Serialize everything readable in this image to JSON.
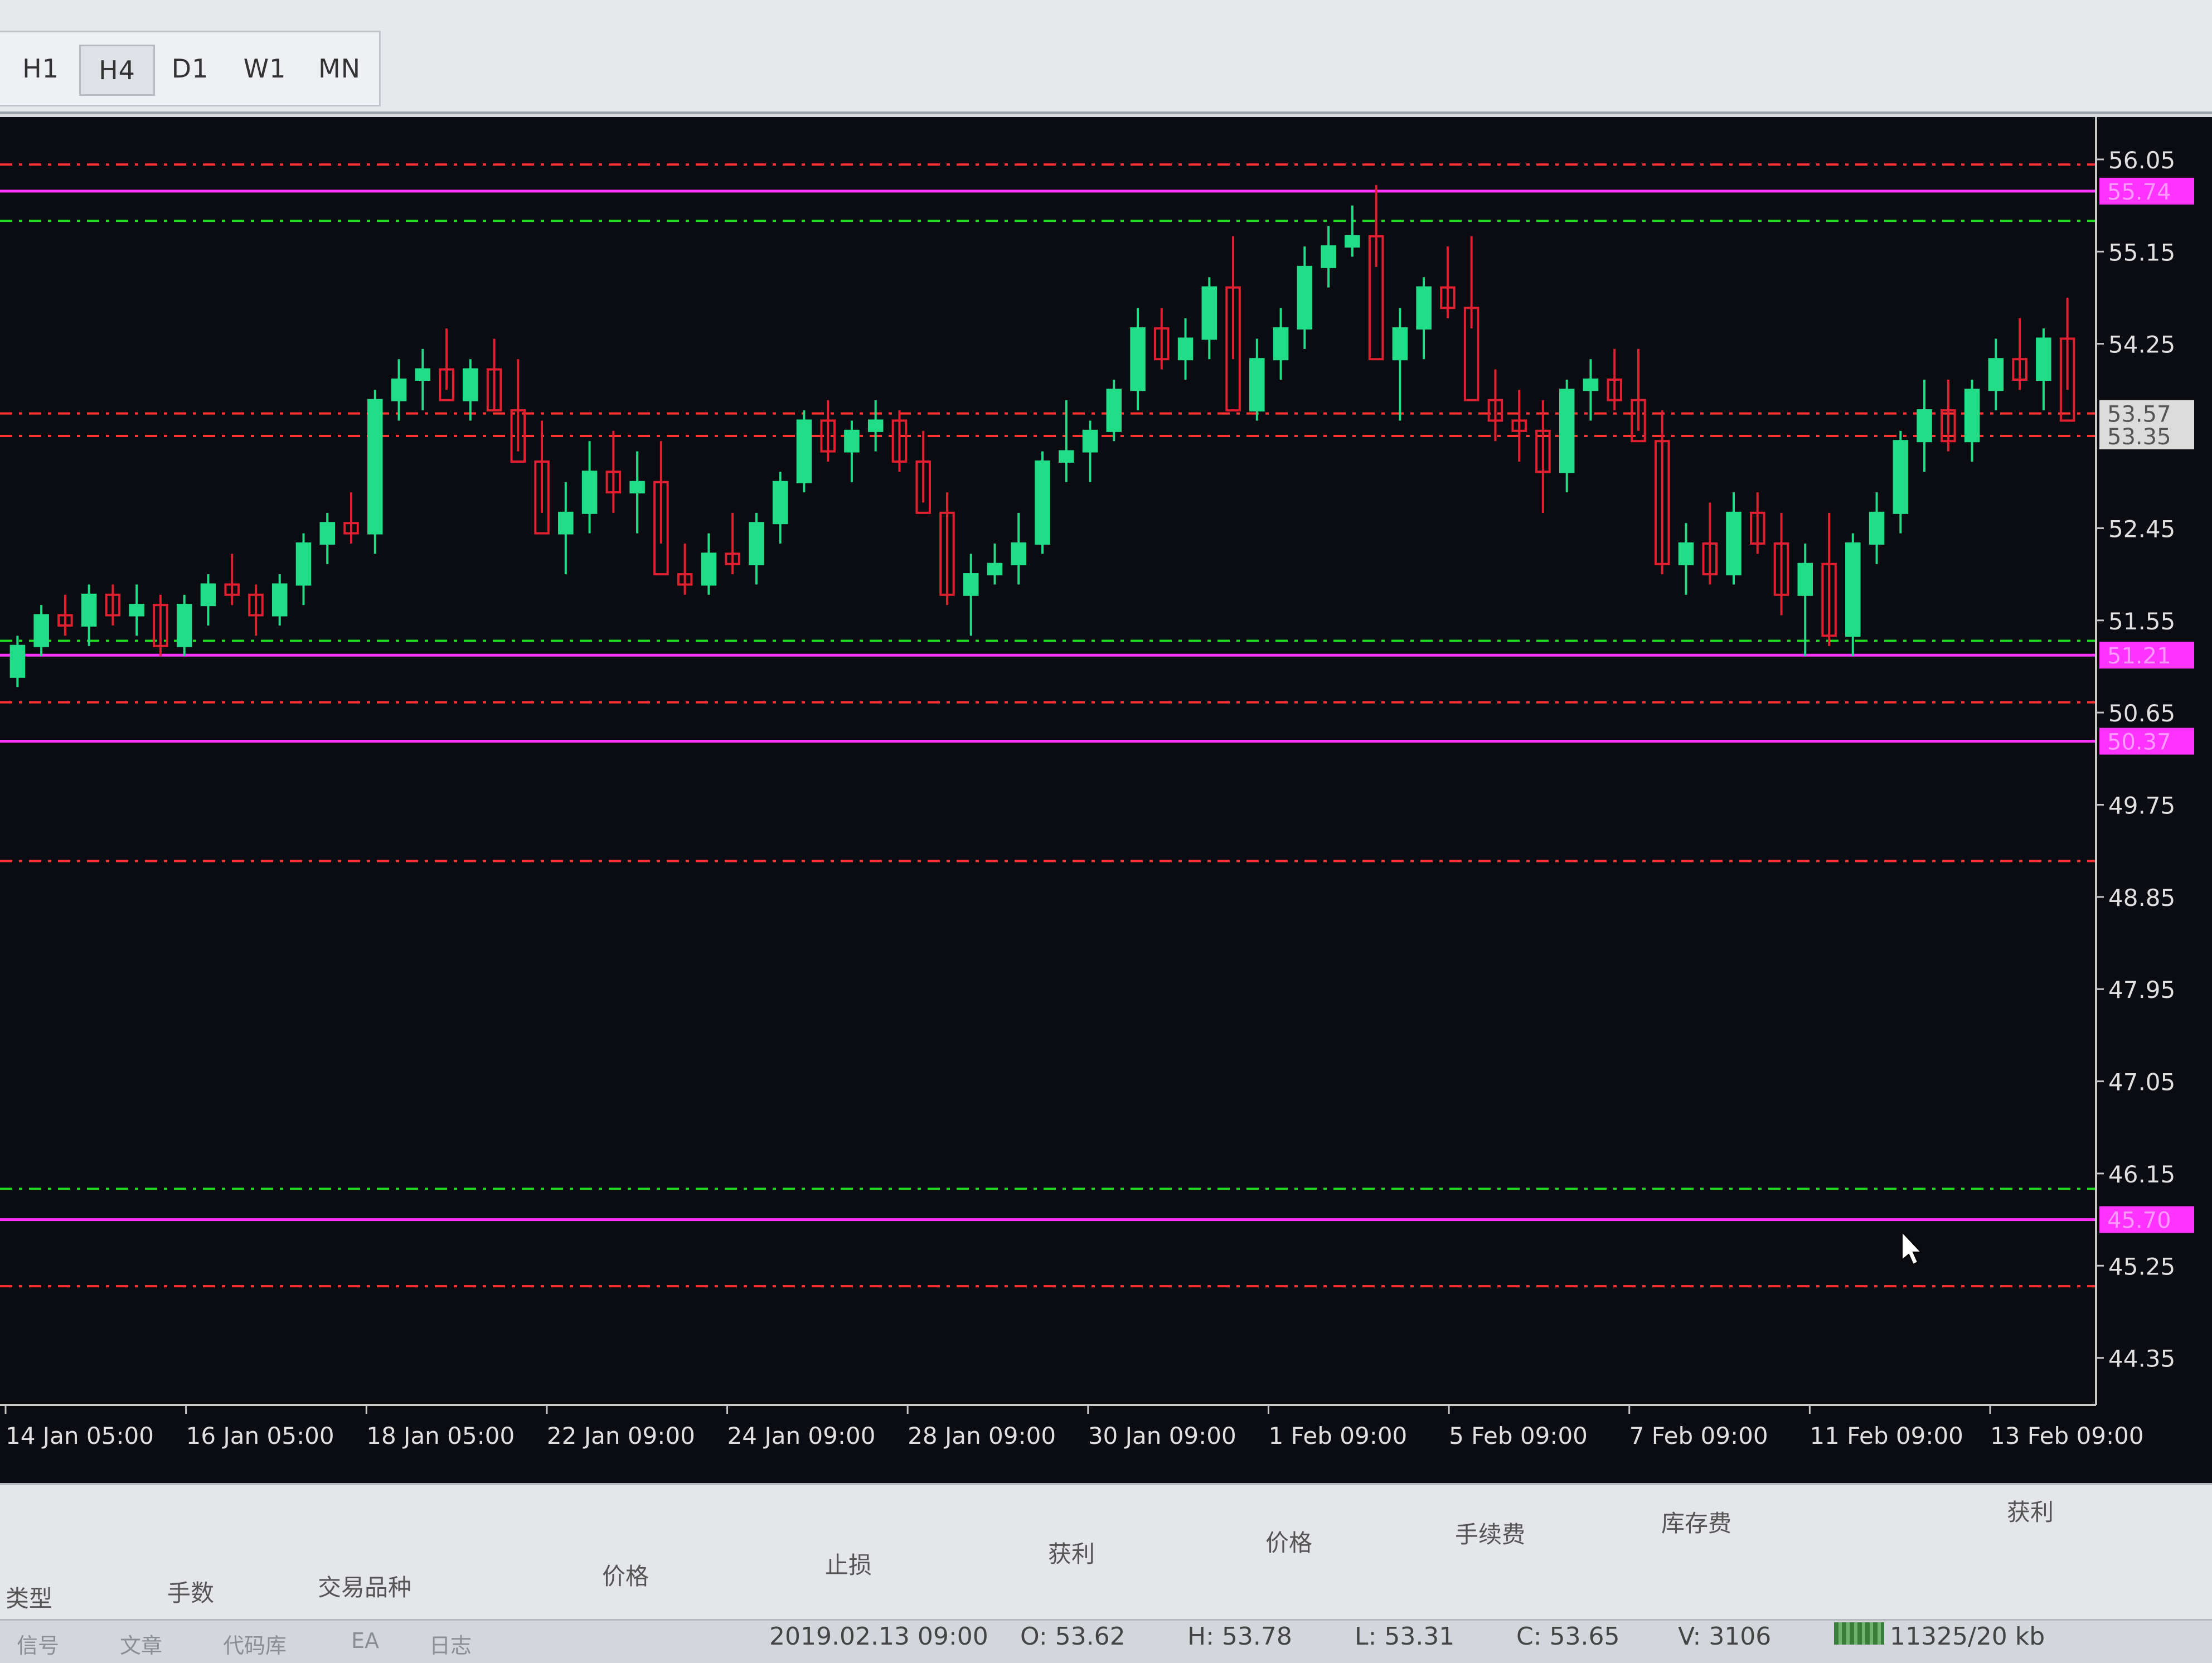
{
  "toolbar": {
    "timeframes": [
      "H1",
      "H4",
      "D1",
      "W1",
      "MN"
    ],
    "active_timeframe": "H4"
  },
  "chart_data": {
    "type": "candlestick",
    "price_scale": {
      "tick_labels": [
        "56.05",
        "55.15",
        "54.25",
        "52.45",
        "51.55",
        "50.65",
        "49.75",
        "48.85",
        "47.95",
        "47.05",
        "46.15",
        "45.25",
        "44.35"
      ],
      "highlighted_labels": [
        {
          "text": "55.74",
          "color": "#ff33ff"
        },
        {
          "text": "53.57",
          "color": "#dcdcdc"
        },
        {
          "text": "53.35",
          "color": "#dcdcdc"
        },
        {
          "text": "51.21",
          "color": "#ff33ff"
        },
        {
          "text": "50.37",
          "color": "#ff33ff"
        },
        {
          "text": "45.70",
          "color": "#ff33ff"
        }
      ],
      "ylim": [
        44.0,
        56.3
      ]
    },
    "time_labels": [
      "14 Jan 05:00",
      "16 Jan 05:00",
      "18 Jan 05:00",
      "22 Jan 09:00",
      "24 Jan 09:00",
      "28 Jan 09:00",
      "30 Jan 09:00",
      "1 Feb 09:00",
      "5 Feb 09:00",
      "7 Feb 09:00",
      "11 Feb 09:00",
      "13 Feb 09:00"
    ],
    "levels": [
      {
        "price": 56.0,
        "style": "dash-dot",
        "color": "#ff3333"
      },
      {
        "price": 55.74,
        "style": "solid",
        "color": "#ff33ff"
      },
      {
        "price": 55.45,
        "style": "dash-dot",
        "color": "#22dd22"
      },
      {
        "price": 53.57,
        "style": "dash-dot",
        "color": "#ff3333"
      },
      {
        "price": 53.35,
        "style": "dash-dot",
        "color": "#ff3333"
      },
      {
        "price": 51.35,
        "style": "dash-dot",
        "color": "#22dd22"
      },
      {
        "price": 51.21,
        "style": "solid",
        "color": "#ff33ff"
      },
      {
        "price": 50.75,
        "style": "dash-dot",
        "color": "#ff3333"
      },
      {
        "price": 50.37,
        "style": "solid",
        "color": "#ff33ff"
      },
      {
        "price": 49.2,
        "style": "dash-dot",
        "color": "#ff3333"
      },
      {
        "price": 46.0,
        "style": "dash-dot",
        "color": "#22dd22"
      },
      {
        "price": 45.7,
        "style": "solid",
        "color": "#ff33ff"
      },
      {
        "price": 45.05,
        "style": "dash-dot",
        "color": "#ff3333"
      }
    ],
    "colors": {
      "background": "#0b0b12",
      "bull": "#22dd88",
      "bear": "#e02030",
      "axis_text": "#e0e0e0"
    },
    "ohlc": [
      [
        51.0,
        51.4,
        50.9,
        51.3
      ],
      [
        51.3,
        51.7,
        51.2,
        51.6
      ],
      [
        51.6,
        51.8,
        51.4,
        51.5
      ],
      [
        51.5,
        51.9,
        51.3,
        51.8
      ],
      [
        51.8,
        51.9,
        51.5,
        51.6
      ],
      [
        51.6,
        51.9,
        51.4,
        51.7
      ],
      [
        51.7,
        51.8,
        51.2,
        51.3
      ],
      [
        51.3,
        51.8,
        51.2,
        51.7
      ],
      [
        51.7,
        52.0,
        51.5,
        51.9
      ],
      [
        51.9,
        52.2,
        51.7,
        51.8
      ],
      [
        51.8,
        51.9,
        51.4,
        51.6
      ],
      [
        51.6,
        52.0,
        51.5,
        51.9
      ],
      [
        51.9,
        52.4,
        51.7,
        52.3
      ],
      [
        52.3,
        52.6,
        52.1,
        52.5
      ],
      [
        52.5,
        52.8,
        52.3,
        52.4
      ],
      [
        52.4,
        53.8,
        52.2,
        53.7
      ],
      [
        53.7,
        54.1,
        53.5,
        53.9
      ],
      [
        53.9,
        54.2,
        53.6,
        54.0
      ],
      [
        54.0,
        54.4,
        53.8,
        53.7
      ],
      [
        53.7,
        54.1,
        53.5,
        54.0
      ],
      [
        54.0,
        54.3,
        53.6,
        53.6
      ],
      [
        53.6,
        54.1,
        53.2,
        53.1
      ],
      [
        53.1,
        53.5,
        52.6,
        52.4
      ],
      [
        52.4,
        52.9,
        52.0,
        52.6
      ],
      [
        52.6,
        53.3,
        52.4,
        53.0
      ],
      [
        53.0,
        53.4,
        52.6,
        52.8
      ],
      [
        52.8,
        53.2,
        52.4,
        52.9
      ],
      [
        52.9,
        53.3,
        52.3,
        52.0
      ],
      [
        52.0,
        52.3,
        51.8,
        51.9
      ],
      [
        51.9,
        52.4,
        51.8,
        52.2
      ],
      [
        52.2,
        52.6,
        52.0,
        52.1
      ],
      [
        52.1,
        52.6,
        51.9,
        52.5
      ],
      [
        52.5,
        53.0,
        52.3,
        52.9
      ],
      [
        52.9,
        53.6,
        52.8,
        53.5
      ],
      [
        53.5,
        53.7,
        53.1,
        53.2
      ],
      [
        53.2,
        53.5,
        52.9,
        53.4
      ],
      [
        53.4,
        53.7,
        53.2,
        53.5
      ],
      [
        53.5,
        53.6,
        53.0,
        53.1
      ],
      [
        53.1,
        53.4,
        52.7,
        52.6
      ],
      [
        52.6,
        52.8,
        51.7,
        51.8
      ],
      [
        51.8,
        52.2,
        51.4,
        52.0
      ],
      [
        52.0,
        52.3,
        51.9,
        52.1
      ],
      [
        52.1,
        52.6,
        51.9,
        52.3
      ],
      [
        52.3,
        53.2,
        52.2,
        53.1
      ],
      [
        53.1,
        53.7,
        52.9,
        53.2
      ],
      [
        53.2,
        53.5,
        52.9,
        53.4
      ],
      [
        53.4,
        53.9,
        53.3,
        53.8
      ],
      [
        53.8,
        54.6,
        53.6,
        54.4
      ],
      [
        54.4,
        54.6,
        54.0,
        54.1
      ],
      [
        54.1,
        54.5,
        53.9,
        54.3
      ],
      [
        54.3,
        54.9,
        54.1,
        54.8
      ],
      [
        54.8,
        55.3,
        54.1,
        53.6
      ],
      [
        53.6,
        54.3,
        53.5,
        54.1
      ],
      [
        54.1,
        54.6,
        53.9,
        54.4
      ],
      [
        54.4,
        55.2,
        54.2,
        55.0
      ],
      [
        55.0,
        55.4,
        54.8,
        55.2
      ],
      [
        55.2,
        55.6,
        55.1,
        55.3
      ],
      [
        55.3,
        55.8,
        55.0,
        54.1
      ],
      [
        54.1,
        54.6,
        53.5,
        54.4
      ],
      [
        54.4,
        54.9,
        54.1,
        54.8
      ],
      [
        54.8,
        55.2,
        54.5,
        54.6
      ],
      [
        54.6,
        55.3,
        54.4,
        53.7
      ],
      [
        53.7,
        54.0,
        53.3,
        53.5
      ],
      [
        53.5,
        53.8,
        53.1,
        53.4
      ],
      [
        53.4,
        53.7,
        52.6,
        53.0
      ],
      [
        53.0,
        53.9,
        52.8,
        53.8
      ],
      [
        53.8,
        54.1,
        53.5,
        53.9
      ],
      [
        53.9,
        54.2,
        53.6,
        53.7
      ],
      [
        53.7,
        54.2,
        53.4,
        53.3
      ],
      [
        53.3,
        53.6,
        52.0,
        52.1
      ],
      [
        52.1,
        52.5,
        51.8,
        52.3
      ],
      [
        52.3,
        52.7,
        51.9,
        52.0
      ],
      [
        52.0,
        52.8,
        51.9,
        52.6
      ],
      [
        52.6,
        52.8,
        52.2,
        52.3
      ],
      [
        52.3,
        52.6,
        51.6,
        51.8
      ],
      [
        51.8,
        52.3,
        51.2,
        52.1
      ],
      [
        52.1,
        52.6,
        51.3,
        51.4
      ],
      [
        51.4,
        52.4,
        51.2,
        52.3
      ],
      [
        52.3,
        52.8,
        52.1,
        52.6
      ],
      [
        52.6,
        53.4,
        52.4,
        53.3
      ],
      [
        53.3,
        53.9,
        53.0,
        53.6
      ],
      [
        53.6,
        53.9,
        53.2,
        53.3
      ],
      [
        53.3,
        53.9,
        53.1,
        53.8
      ],
      [
        53.8,
        54.3,
        53.6,
        54.1
      ],
      [
        54.1,
        54.5,
        53.8,
        53.9
      ],
      [
        53.9,
        54.4,
        53.6,
        54.3
      ],
      [
        54.3,
        54.7,
        53.8,
        53.5
      ]
    ]
  },
  "terminal": {
    "columns": [
      "类型",
      "手数",
      "交易品种",
      "价格",
      "止损",
      "获利",
      "价格",
      "手续费",
      "库存费",
      "获利"
    ],
    "tabs": [
      "信号",
      "文章",
      "代码库",
      "EA",
      "日志"
    ]
  },
  "status_bar": {
    "datetime": "2019.02.13 09:00",
    "open": "O: 53.62",
    "high": "H: 53.78",
    "low": "L: 53.31",
    "close": "C: 53.65",
    "volume": "V: 3106",
    "traffic": "11325/20 kb"
  }
}
